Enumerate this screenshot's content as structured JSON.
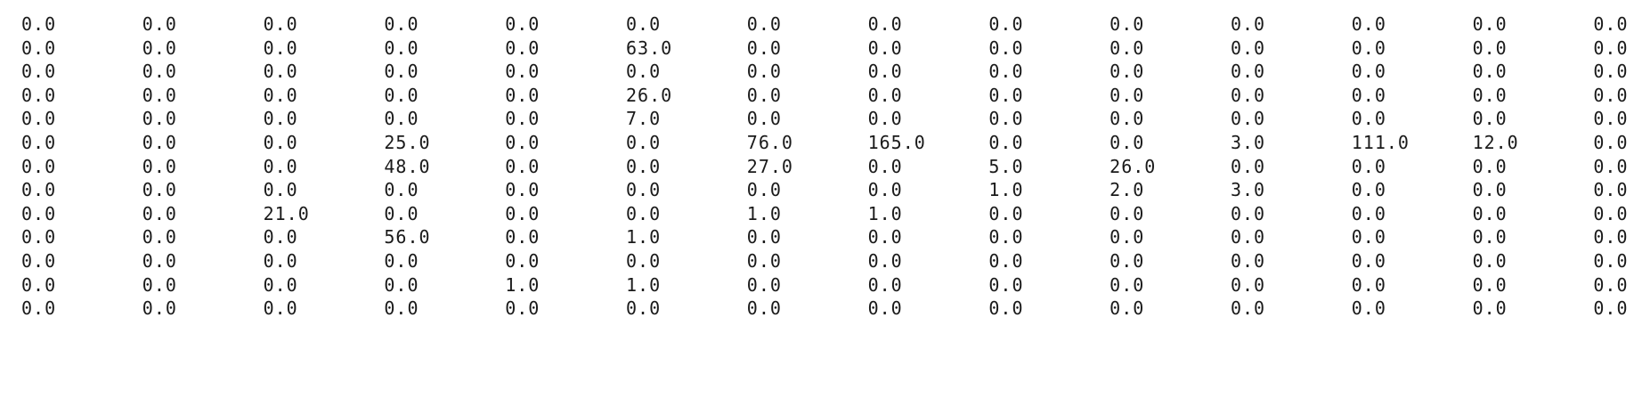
{
  "matrix": {
    "rows": [
      [
        "0.0",
        "0.0",
        "0.0",
        "0.0",
        "0.0",
        "0.0",
        "0.0",
        "0.0",
        "0.0",
        "0.0",
        "0.0",
        "0.0",
        "0.0",
        "0.0"
      ],
      [
        "0.0",
        "0.0",
        "0.0",
        "0.0",
        "0.0",
        "63.0",
        "0.0",
        "0.0",
        "0.0",
        "0.0",
        "0.0",
        "0.0",
        "0.0",
        "0.0"
      ],
      [
        "0.0",
        "0.0",
        "0.0",
        "0.0",
        "0.0",
        "0.0",
        "0.0",
        "0.0",
        "0.0",
        "0.0",
        "0.0",
        "0.0",
        "0.0",
        "0.0"
      ],
      [
        "0.0",
        "0.0",
        "0.0",
        "0.0",
        "0.0",
        "26.0",
        "0.0",
        "0.0",
        "0.0",
        "0.0",
        "0.0",
        "0.0",
        "0.0",
        "0.0"
      ],
      [
        "0.0",
        "0.0",
        "0.0",
        "0.0",
        "0.0",
        "7.0",
        "0.0",
        "0.0",
        "0.0",
        "0.0",
        "0.0",
        "0.0",
        "0.0",
        "0.0"
      ],
      [
        "0.0",
        "0.0",
        "0.0",
        "25.0",
        "0.0",
        "0.0",
        "76.0",
        "165.0",
        "0.0",
        "0.0",
        "3.0",
        "111.0",
        "12.0",
        "0.0"
      ],
      [
        "0.0",
        "0.0",
        "0.0",
        "48.0",
        "0.0",
        "0.0",
        "27.0",
        "0.0",
        "5.0",
        "26.0",
        "0.0",
        "0.0",
        "0.0",
        "0.0"
      ],
      [
        "0.0",
        "0.0",
        "0.0",
        "0.0",
        "0.0",
        "0.0",
        "0.0",
        "0.0",
        "1.0",
        "2.0",
        "3.0",
        "0.0",
        "0.0",
        "0.0"
      ],
      [
        "0.0",
        "0.0",
        "21.0",
        "0.0",
        "0.0",
        "0.0",
        "1.0",
        "1.0",
        "0.0",
        "0.0",
        "0.0",
        "0.0",
        "0.0",
        "0.0"
      ],
      [
        "0.0",
        "0.0",
        "0.0",
        "56.0",
        "0.0",
        "1.0",
        "0.0",
        "0.0",
        "0.0",
        "0.0",
        "0.0",
        "0.0",
        "0.0",
        "0.0"
      ],
      [
        "0.0",
        "0.0",
        "0.0",
        "0.0",
        "0.0",
        "0.0",
        "0.0",
        "0.0",
        "0.0",
        "0.0",
        "0.0",
        "0.0",
        "0.0",
        "0.0"
      ],
      [
        "0.0",
        "0.0",
        "0.0",
        "0.0",
        "1.0",
        "1.0",
        "0.0",
        "0.0",
        "0.0",
        "0.0",
        "0.0",
        "0.0",
        "0.0",
        "0.0"
      ],
      [
        "0.0",
        "0.0",
        "0.0",
        "0.0",
        "0.0",
        "0.0",
        "0.0",
        "0.0",
        "0.0",
        "0.0",
        "0.0",
        "0.0",
        "0.0",
        "0.0"
      ]
    ]
  }
}
